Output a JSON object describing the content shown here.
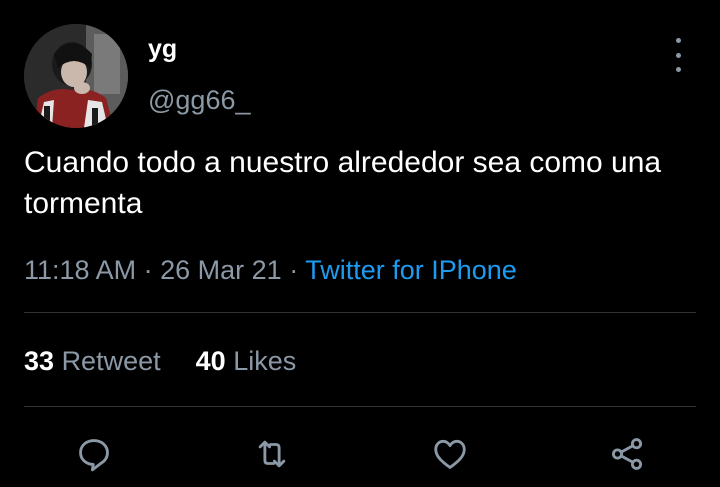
{
  "user": {
    "display_name": "yg",
    "handle": "@gg66_"
  },
  "tweet": {
    "text": "Cuando todo a nuestro alrededor sea como una tormenta",
    "time": "11:18 AM",
    "date": "26 Mar 21",
    "separator": "·",
    "source": "Twitter for IPhone"
  },
  "stats": {
    "retweet_count": "33",
    "retweet_label": "Retweet",
    "likes_count": "40",
    "likes_label": "Likes"
  },
  "actions": [
    "reply-icon",
    "retweet-icon",
    "like-icon",
    "share-icon"
  ],
  "colors": {
    "background": "#000000",
    "text": "#ffffff",
    "secondary": "#8b98a5",
    "accent": "#1d9bf0",
    "divider": "#2f3336"
  }
}
